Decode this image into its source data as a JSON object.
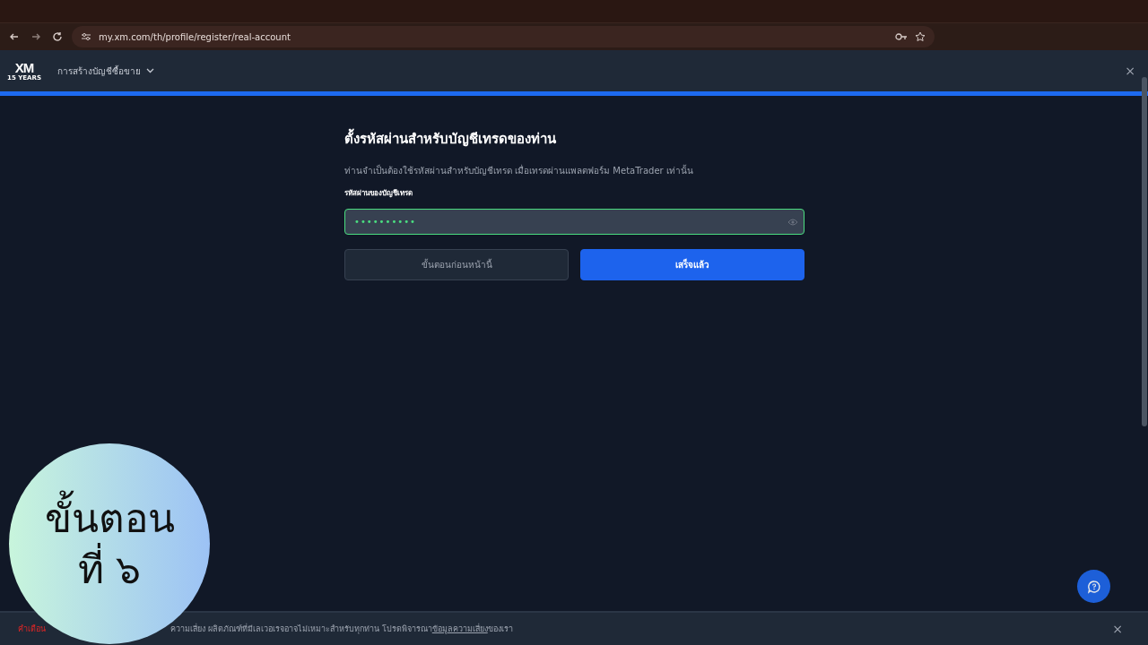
{
  "browser": {
    "url": "my.xm.com/th/profile/register/real-account"
  },
  "header": {
    "logo": "XM",
    "logo_sub": "15 YEARS",
    "menu": "การสร้างบัญชีซื้อขาย",
    "close": "×"
  },
  "progress": {
    "level": 1
  },
  "form": {
    "title": "ตั้งรหัสผ่านสำหรับบัญชีเทรดของท่าน",
    "description": "ท่านจำเป็นต้องใช้รหัสผ่านสำหรับบัญชีเทรด เมื่อเทรดผ่านแพลตฟอร์ม MetaTrader เท่านั้น",
    "field_label": "รหัสผ่านของบัญชีเทรด",
    "password_value": "••••••••••",
    "buttons": [
      {
        "label": "ขั้นตอนก่อนหน้านี้",
        "kind": "secondary"
      },
      {
        "label": "เสร็จแล้ว",
        "kind": "primary"
      }
    ]
  },
  "risk_banner": {
    "label": "คำเตือน",
    "text": "ความเสี่ยง ผลิตภัณฑ์ที่มีเลเวอเรจอาจไม่เหมาะสำหรับทุกท่าน โปรดพิจารณา",
    "link": "ข้อมูลความเสี่ยง",
    "suffix": "ของเรา",
    "close": "×"
  },
  "step_badge": {
    "line1": "ขั้นตอน",
    "line2": "ที่ ๖"
  }
}
